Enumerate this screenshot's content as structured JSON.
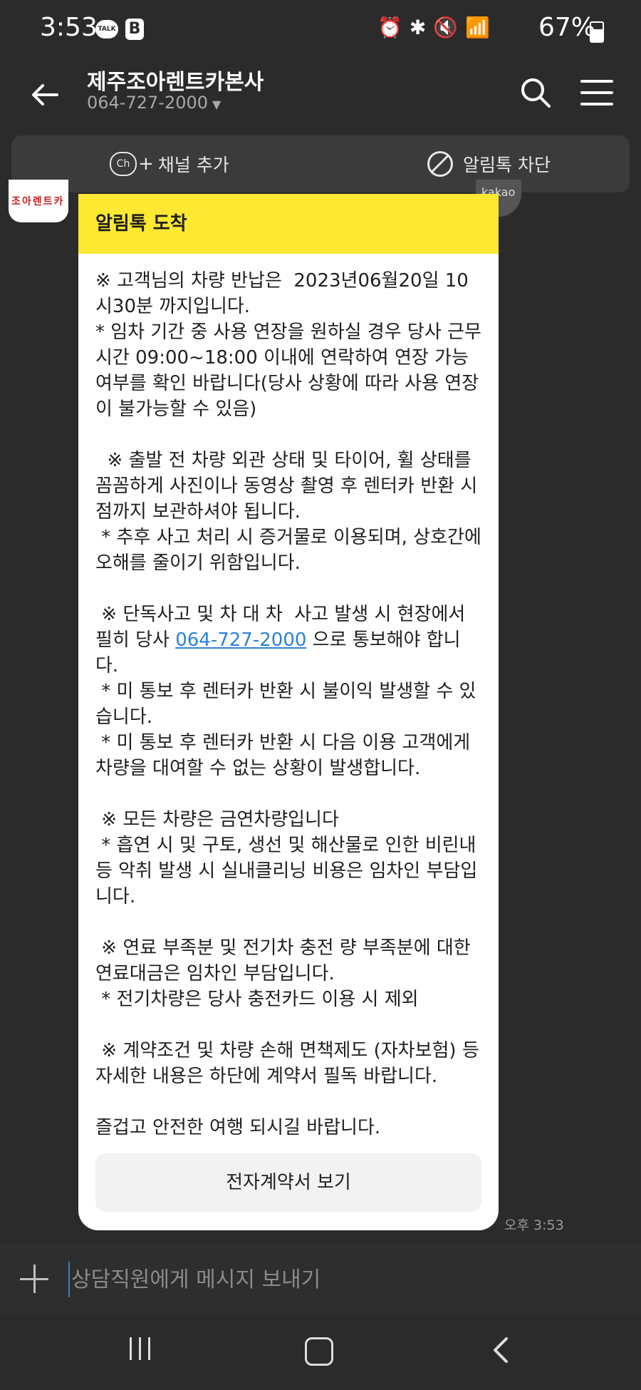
{
  "status_bar": {
    "time": "3:53",
    "talk_badge": "TALK",
    "b_badge": "B",
    "icons": [
      "alarm-icon",
      "bluetooth-icon",
      "mute-icon",
      "hd-voice-icon",
      "lte-icon",
      "signal-icon"
    ],
    "battery": "67%"
  },
  "header": {
    "title": "제주조아렌트카본사",
    "subtitle": "064-727-2000"
  },
  "channel_bar": {
    "ch_icon": "Ch",
    "add_channel": "채널 추가",
    "block": "알림톡 차단"
  },
  "avatar": {
    "text": "조아렌트카"
  },
  "kakao_badge": "kakao",
  "message": {
    "header": "알림톡 도착",
    "p1": "※ 고객님의 차량 반납은  2023년06월20일 10시30분 까지입니다.\n* 임차 기간 중 사용 연장을 원하실 경우 당사 근무시간 09:00~18:00 이내에 연락하여 연장 가능 여부를 확인 바랍니다(당사 상황에 따라 사용 연장이 불가능할 수 있음)",
    "p2": "  ※ 출발 전 차량 외관 상태 및 타이어, 휠 상태를 꼼꼼하게 사진이나 동영상 촬영 후 렌터카 반환 시점까지 보관하셔야 됩니다.\n * 추후 사고 처리 시 증거물로 이용되며, 상호간에 오해를 줄이기 위함입니다.",
    "p3_prefix": " ※ 단독사고 및 차 대 차  사고 발생 시 현장에서 필히 당사 ",
    "p3_link": "064-727-2000",
    "p3_suffix": " 으로 통보해야 합니다.\n * 미 통보 후 렌터카 반환 시 불이익 발생할 수 있습니다.\n * 미 통보 후 렌터카 반환 시 다음 이용 고객에게 차량을 대여할 수 없는 상황이 발생합니다.",
    "p4": " ※ 모든 차량은 금연차량입니다\n * 흡연 시 및 구토, 생선 및 해산물로 인한 비린내 등 악취 발생 시 실내클리닝 비용은 임차인 부담입니다.",
    "p5": " ※ 연료 부족분 및 전기차 충전 량 부족분에 대한 연료대금은 임차인 부담입니다.\n * 전기차량은 당사 충전카드 이용 시 제외",
    "p6": " ※ 계약조건 및 차량 손해 면책제도 (자차보험) 등 자세한 내용은 하단에 계약서 필독 바랍니다.",
    "p7": "즐겁고 안전한 여행 되시길 바랍니다.",
    "button": "전자계약서 보기",
    "time": "오후 3:53"
  },
  "input": {
    "placeholder": "상담직원에게 메시지 보내기"
  },
  "colors": {
    "accent_yellow": "#fee832",
    "link_blue": "#2f80d8",
    "background": "#2b2b2b"
  }
}
